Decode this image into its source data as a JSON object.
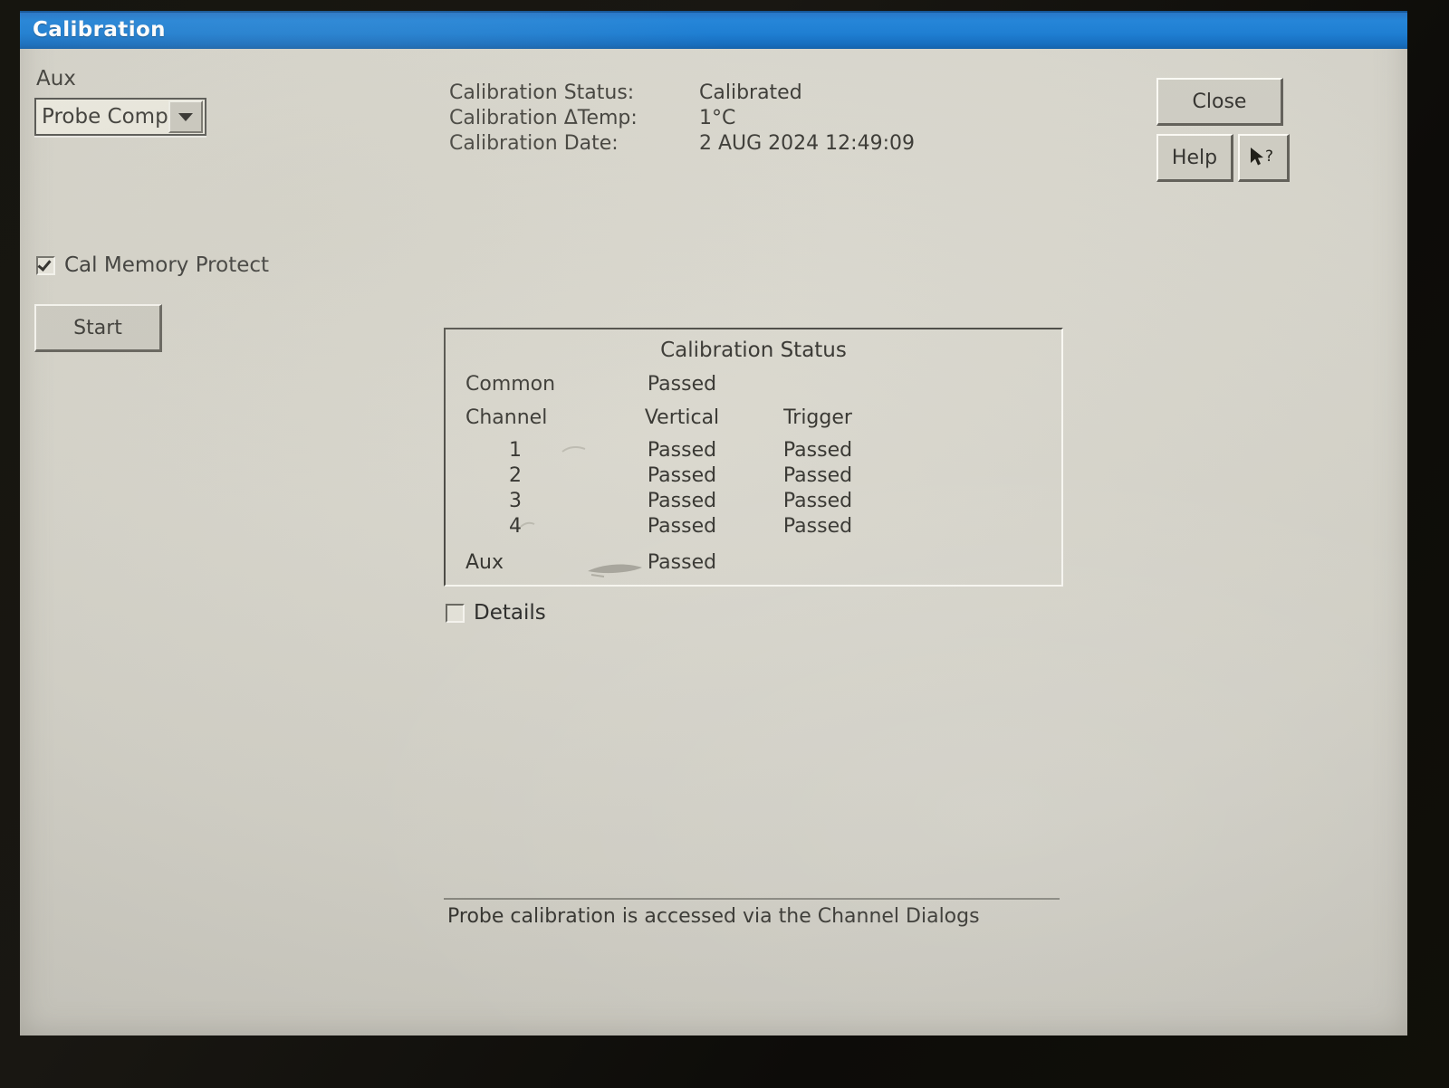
{
  "window": {
    "title": "Calibration"
  },
  "aux_selector": {
    "label": "Aux",
    "value": "Probe Comp",
    "arrow_icon": "chevron-down-icon"
  },
  "status_readout": {
    "rows": [
      {
        "label": "Calibration Status:",
        "value": "Calibrated"
      },
      {
        "label": "Calibration ΔTemp:",
        "value": "1°C"
      },
      {
        "label": "Calibration Date:",
        "value": "2 AUG 2024 12:49:09"
      }
    ]
  },
  "buttons": {
    "close": "Close",
    "help": "Help",
    "context_help_icon": "cursor-question-icon"
  },
  "options": {
    "cal_memory_protect": {
      "label": "Cal Memory Protect",
      "checked": true
    },
    "details": {
      "label": "Details",
      "checked": false
    },
    "start_button": "Start"
  },
  "cal_status_panel": {
    "title": "Calibration Status",
    "common_label": "Common",
    "common_value": "Passed",
    "headers": {
      "channel": "Channel",
      "vertical": "Vertical",
      "trigger": "Trigger"
    },
    "channels": [
      {
        "name": "1",
        "vertical": "Passed",
        "trigger": "Passed"
      },
      {
        "name": "2",
        "vertical": "Passed",
        "trigger": "Passed"
      },
      {
        "name": "3",
        "vertical": "Passed",
        "trigger": "Passed"
      },
      {
        "name": "4",
        "vertical": "Passed",
        "trigger": "Passed"
      }
    ],
    "aux_label": "Aux",
    "aux_value": "Passed"
  },
  "message_bar": {
    "text": "Probe calibration is accessed via the Channel Dialogs"
  },
  "colors": {
    "titlebar_blue": "#1378d0",
    "screen_gray": "#d6d4ca",
    "text": "#35342f"
  }
}
